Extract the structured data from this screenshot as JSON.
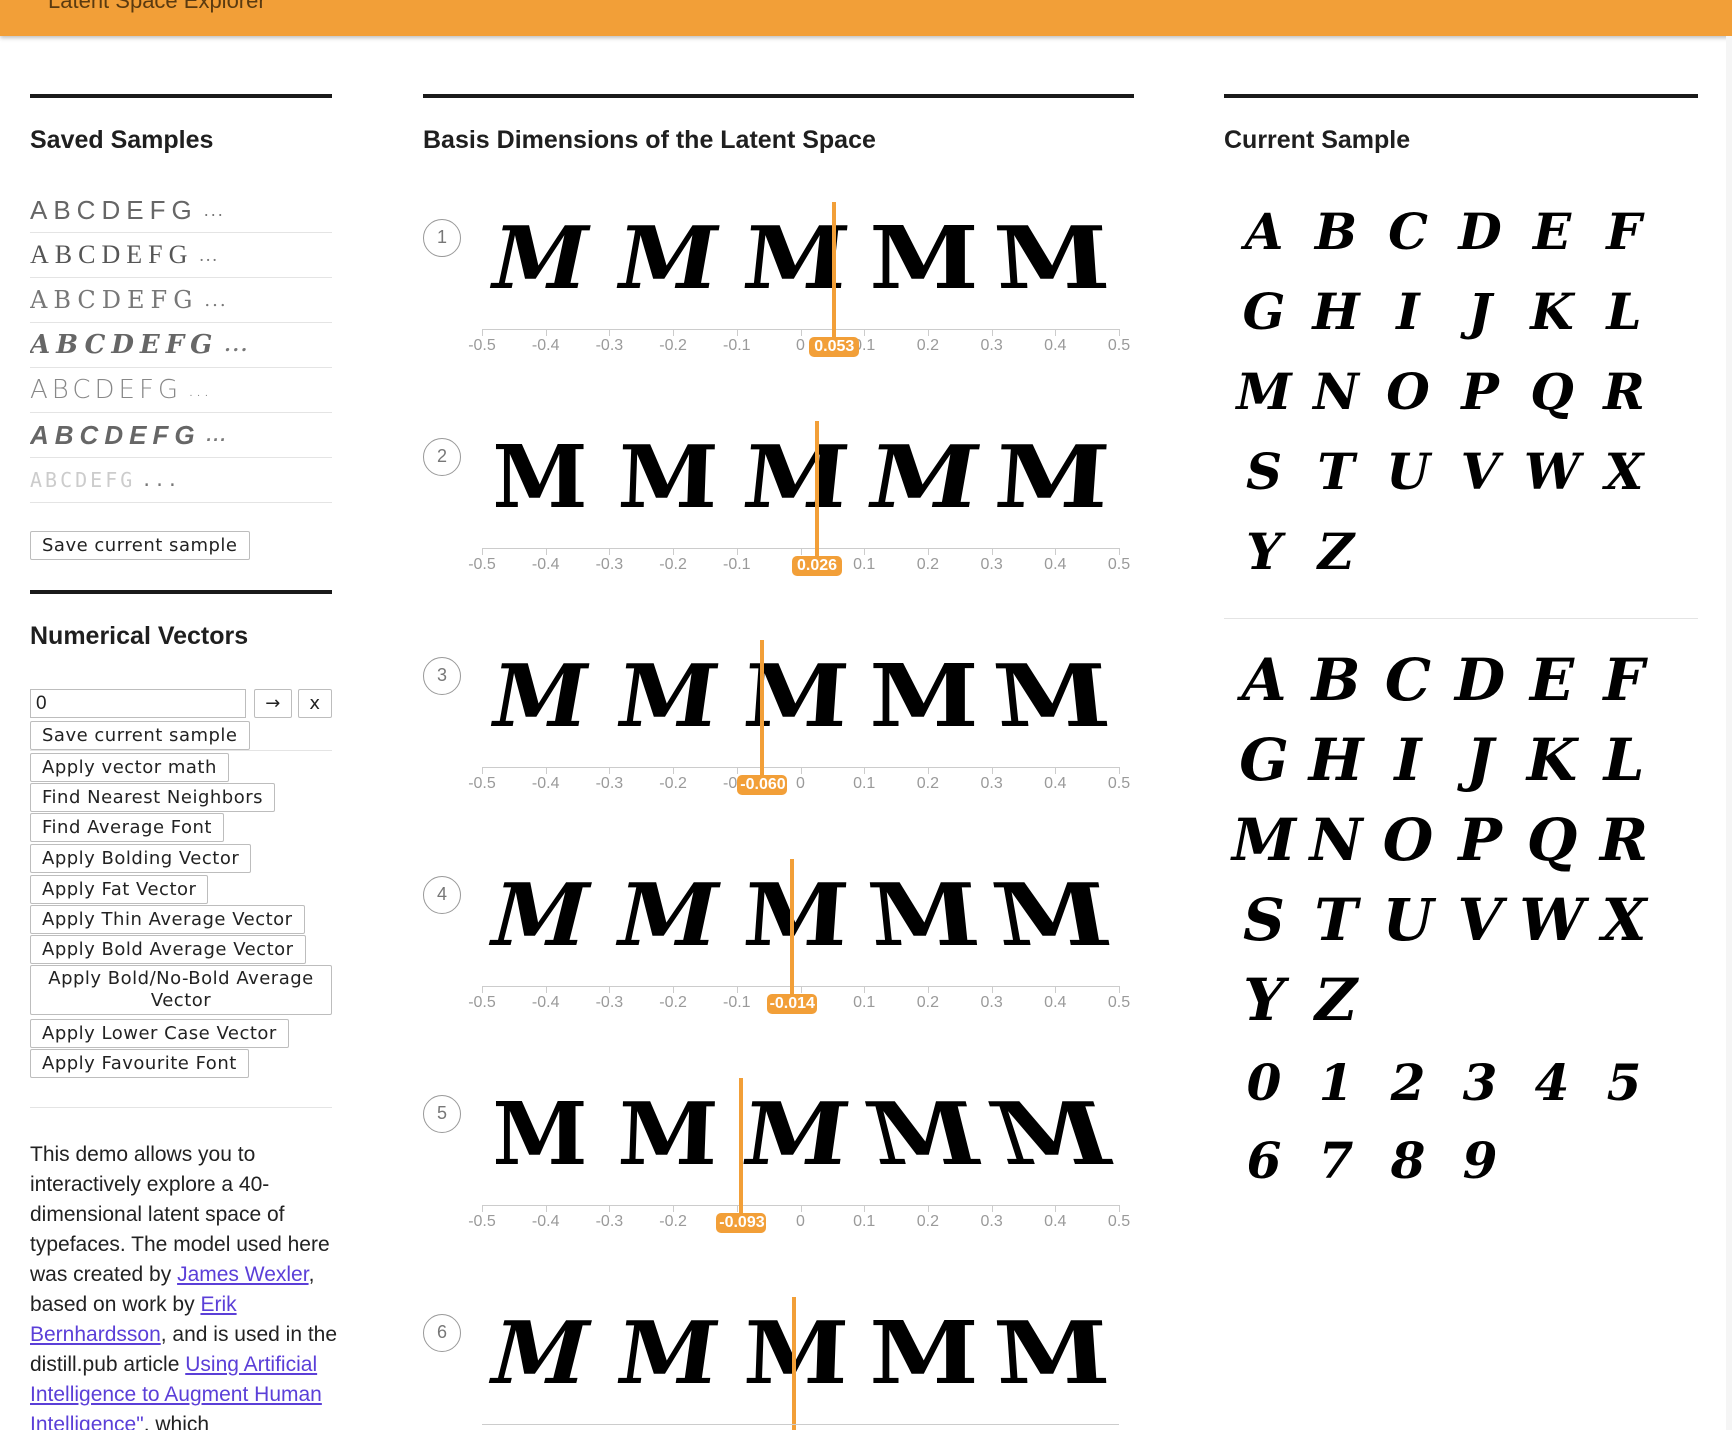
{
  "header": {
    "title": "Latent Space Explorer"
  },
  "left": {
    "saved_title": "Saved Samples",
    "saved_samples": [
      "ABCDEFG",
      "ABCDEFG",
      "ABCDEFG",
      "ABCDEFG",
      "ABCDEFG",
      "ABCDEFG",
      "ABCDEFG"
    ],
    "ellipsis": "...",
    "save_button": "Save current sample",
    "vectors_title": "Numerical Vectors",
    "vector_input_value": "0",
    "go_label": "→",
    "clear_label": "x",
    "buttons": [
      "Save current sample",
      "Apply vector math",
      "Find Nearest Neighbors",
      "Find Average Font",
      "Apply Bolding Vector",
      "Apply Fat Vector",
      "Apply Thin Average Vector",
      "Apply Bold Average Vector",
      "Apply Bold/No-Bold Average Vector",
      "Apply Lower Case Vector",
      "Apply Favourite Font"
    ],
    "desc": {
      "p1": "This demo allows you to interactively explore a 40-dimensional latent space of typefaces. The model used here was created by ",
      "link1": "James Wexler",
      "p2": ", based on work by ",
      "link2": "Erik Bernhardsson",
      "p3": ", and is used in the distill.pub article ",
      "link3": "Using Artificial Intelligence to Augment Human Intelligence\"",
      "p4": ", which"
    }
  },
  "middle": {
    "title": "Basis Dimensions of the Latent Space",
    "tick_labels": [
      "-0.5",
      "-0.4",
      "-0.3",
      "-0.2",
      "-0.1",
      "0",
      "0.1",
      "0.2",
      "0.3",
      "0.4",
      "0.5"
    ],
    "glyph": "M",
    "dimensions": [
      {
        "num": "1",
        "value": 0.053,
        "label": "0.053"
      },
      {
        "num": "2",
        "value": 0.026,
        "label": "0.026"
      },
      {
        "num": "3",
        "value": -0.06,
        "label": "-0.060"
      },
      {
        "num": "4",
        "value": -0.014,
        "label": "-0.014"
      },
      {
        "num": "5",
        "value": -0.093,
        "label": "-0.093"
      },
      {
        "num": "6",
        "value": -0.01,
        "label": ""
      }
    ]
  },
  "right": {
    "title": "Current Sample",
    "grid_small": [
      "A",
      "B",
      "C",
      "D",
      "E",
      "F",
      "G",
      "H",
      "I",
      "J",
      "K",
      "L",
      "M",
      "N",
      "O",
      "P",
      "Q",
      "R",
      "S",
      "T",
      "U",
      "V",
      "W",
      "X",
      "Y",
      "Z"
    ],
    "grid_large": [
      "A",
      "B",
      "C",
      "D",
      "E",
      "F",
      "G",
      "H",
      "I",
      "J",
      "K",
      "L",
      "M",
      "N",
      "O",
      "P",
      "Q",
      "R",
      "S",
      "T",
      "U",
      "V",
      "W",
      "X",
      "Y",
      "Z"
    ],
    "digits": [
      "0",
      "1",
      "2",
      "3",
      "4",
      "5",
      "6",
      "7",
      "8",
      "9"
    ]
  },
  "colors": {
    "accent": "#f29f38",
    "link": "#5b3fd8"
  }
}
